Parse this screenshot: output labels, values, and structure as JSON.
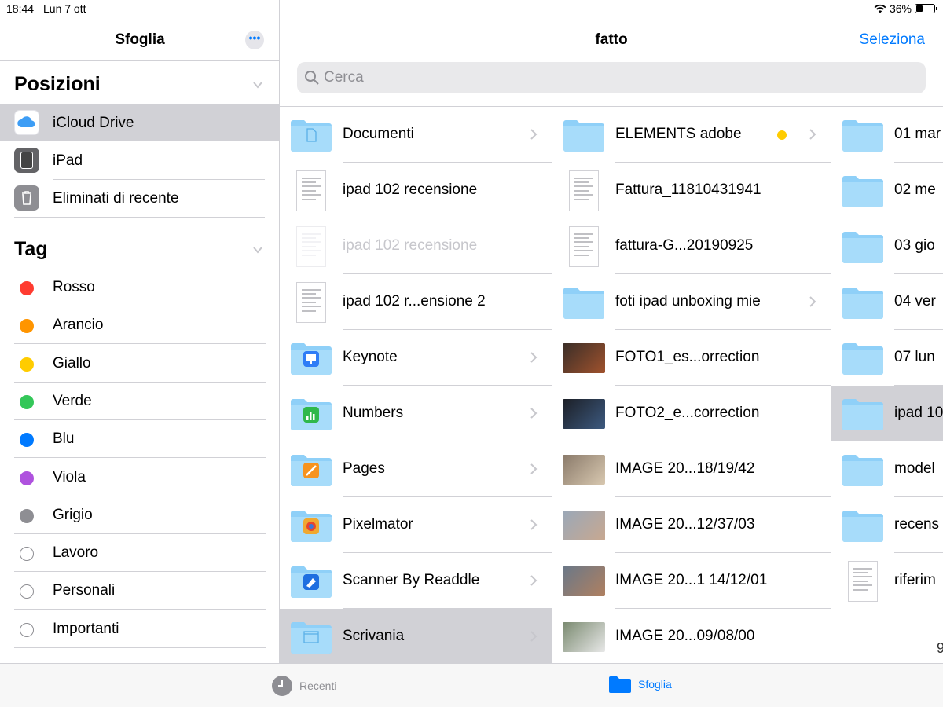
{
  "status": {
    "time": "18:44",
    "date": "Lun 7 ott",
    "battery": "36%",
    "battery_level": 0.36
  },
  "sidebar": {
    "title": "Sfoglia",
    "more_label": "•••",
    "locations_header": "Posizioni",
    "locations": [
      {
        "label": "iCloud Drive",
        "icon": "icloud-icon",
        "selected": true
      },
      {
        "label": "iPad",
        "icon": "ipad-icon",
        "selected": false
      },
      {
        "label": "Eliminati di recente",
        "icon": "trash-icon",
        "selected": false
      }
    ],
    "tags_header": "Tag",
    "tags": [
      {
        "label": "Rosso",
        "color": "#ff3b30"
      },
      {
        "label": "Arancio",
        "color": "#ff9500"
      },
      {
        "label": "Giallo",
        "color": "#ffcc00"
      },
      {
        "label": "Verde",
        "color": "#34c759"
      },
      {
        "label": "Blu",
        "color": "#007aff"
      },
      {
        "label": "Viola",
        "color": "#af52de"
      },
      {
        "label": "Grigio",
        "color": "#8e8e93"
      },
      {
        "label": "Lavoro",
        "color": ""
      },
      {
        "label": "Personali",
        "color": ""
      },
      {
        "label": "Importanti",
        "color": ""
      }
    ]
  },
  "main": {
    "title": "fatto",
    "select_label": "Seleziona",
    "search_placeholder": "Cerca"
  },
  "columns": {
    "col1": [
      {
        "name": "Documenti",
        "type": "folder",
        "badge": "doc-icon",
        "chevron": true
      },
      {
        "name": "ipad 102 recensione",
        "type": "document",
        "chevron": false
      },
      {
        "name": "ipad 102 recensione",
        "type": "document-dim",
        "chevron": false,
        "dim": true
      },
      {
        "name": "ipad 102 r...ensione 2",
        "type": "document",
        "chevron": false
      },
      {
        "name": "Keynote",
        "type": "folder",
        "badge": "keynote-icon",
        "chevron": true
      },
      {
        "name": "Numbers",
        "type": "folder",
        "badge": "numbers-icon",
        "chevron": true
      },
      {
        "name": "Pages",
        "type": "folder",
        "badge": "pages-icon",
        "chevron": true
      },
      {
        "name": "Pixelmator",
        "type": "folder",
        "badge": "pixelmator-icon",
        "chevron": true
      },
      {
        "name": "Scanner By Readdle",
        "type": "folder",
        "badge": "scanner-icon",
        "chevron": true
      },
      {
        "name": "Scrivania",
        "type": "folder",
        "badge": "desktop-icon",
        "chevron": true,
        "selected": true
      }
    ],
    "col2": [
      {
        "name": "ELEMENTS adobe",
        "type": "folder",
        "chevron": true,
        "tag_color": "#ffcc00"
      },
      {
        "name": "Fattura_11810431941",
        "type": "document",
        "chevron": false
      },
      {
        "name": "fattura-G...20190925",
        "type": "document",
        "chevron": false
      },
      {
        "name": "foti ipad unboxing mie",
        "type": "folder",
        "chevron": true
      },
      {
        "name": "FOTO1_es...orrection",
        "type": "image",
        "chevron": false,
        "thumb": [
          "#3a2e28",
          "#a0522d"
        ]
      },
      {
        "name": "FOTO2_e...correction",
        "type": "image",
        "chevron": false,
        "thumb": [
          "#1c1f26",
          "#3d5a80"
        ]
      },
      {
        "name": "IMAGE 20...18/19/42",
        "type": "image",
        "chevron": false,
        "thumb": [
          "#8a7a6a",
          "#d8c8b0"
        ]
      },
      {
        "name": "IMAGE 20...12/37/03",
        "type": "image",
        "chevron": false,
        "thumb": [
          "#9aa8b8",
          "#c8a890"
        ]
      },
      {
        "name": "IMAGE 20...1 14/12/01",
        "type": "image",
        "chevron": false,
        "thumb": [
          "#6a7888",
          "#b08060"
        ]
      },
      {
        "name": "IMAGE 20...09/08/00",
        "type": "image",
        "chevron": false,
        "thumb": [
          "#7a8a70",
          "#e8e8e8"
        ]
      }
    ],
    "col3": [
      {
        "name": "01 mar",
        "type": "folder"
      },
      {
        "name": "02 me",
        "type": "folder"
      },
      {
        "name": "03 gio",
        "type": "folder"
      },
      {
        "name": "04 ver",
        "type": "folder"
      },
      {
        "name": "07 lun",
        "type": "folder"
      },
      {
        "name": "ipad 10",
        "type": "folder",
        "selected": true
      },
      {
        "name": "model",
        "type": "folder"
      },
      {
        "name": "recens",
        "type": "folder"
      },
      {
        "name": "riferim",
        "type": "document"
      }
    ],
    "col3_count_peek": "9"
  },
  "tabbar": {
    "recents_label": "Recenti",
    "browse_label": "Sfoglia"
  },
  "colors": {
    "accent": "#007aff",
    "folder": "#8fd0f8",
    "selection": "#d1d1d6"
  }
}
